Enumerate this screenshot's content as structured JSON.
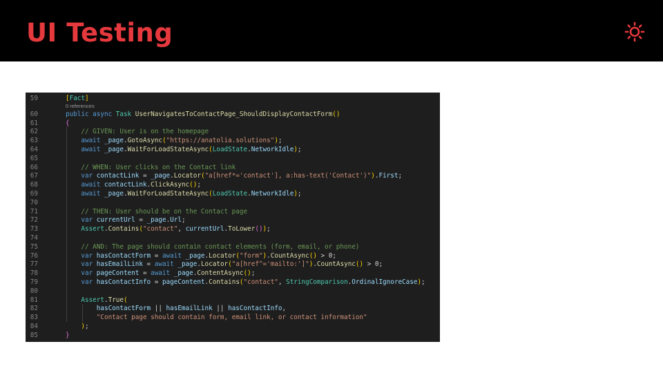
{
  "slide": {
    "title": "UI Testing",
    "icon": "sun-icon",
    "accent_color": "#e5393e"
  },
  "editor": {
    "codelens": "0 references",
    "line_numbers": [
      "59",
      "60",
      "61",
      "62",
      "63",
      "64",
      "65",
      "66",
      "67",
      "68",
      "69",
      "70",
      "71",
      "72",
      "73",
      "74",
      "75",
      "76",
      "77",
      "78",
      "79",
      "80",
      "81",
      "82",
      "83",
      "84",
      "85"
    ],
    "lines": [
      [
        {
          "t": "[",
          "c": "br2"
        },
        {
          "t": "Fact",
          "c": "at"
        },
        {
          "t": "]",
          "c": "br2"
        }
      ],
      [
        {
          "t": "public async ",
          "c": "kw"
        },
        {
          "t": "Task ",
          "c": "ty"
        },
        {
          "t": "UserNavigatesToContactPage_ShouldDisplayContactForm",
          "c": "fn"
        },
        {
          "t": "()",
          "c": "br2"
        }
      ],
      [
        {
          "t": "{",
          "c": "br"
        }
      ],
      [
        {
          "t": "    // GIVEN: User is on the homepage",
          "c": "cm"
        }
      ],
      [
        {
          "t": "    await ",
          "c": "kw"
        },
        {
          "t": "_page",
          "c": "vr"
        },
        {
          "t": "."
        },
        {
          "t": "GotoAsync",
          "c": "fn"
        },
        {
          "t": "(",
          "c": "br2"
        },
        {
          "t": "\"https://anatolia.solutions\"",
          "c": "st"
        },
        {
          "t": ")",
          "c": "br2"
        },
        {
          "t": ";"
        }
      ],
      [
        {
          "t": "    await ",
          "c": "kw"
        },
        {
          "t": "_page",
          "c": "vr"
        },
        {
          "t": "."
        },
        {
          "t": "WaitForLoadStateAsync",
          "c": "fn"
        },
        {
          "t": "(",
          "c": "br2"
        },
        {
          "t": "LoadState",
          "c": "ty"
        },
        {
          "t": "."
        },
        {
          "t": "NetworkIdle",
          "c": "vr"
        },
        {
          "t": ")",
          "c": "br2"
        },
        {
          "t": ";"
        }
      ],
      [],
      [
        {
          "t": "    // WHEN: User clicks on the Contact link",
          "c": "cm"
        }
      ],
      [
        {
          "t": "    var ",
          "c": "kw"
        },
        {
          "t": "contactLink",
          "c": "vr"
        },
        {
          "t": " = "
        },
        {
          "t": "_page",
          "c": "vr"
        },
        {
          "t": "."
        },
        {
          "t": "Locator",
          "c": "fn"
        },
        {
          "t": "(",
          "c": "br2"
        },
        {
          "t": "\"a[href*='contact'], a:has-text('Contact')\"",
          "c": "st"
        },
        {
          "t": ")",
          "c": "br2"
        },
        {
          "t": "."
        },
        {
          "t": "First",
          "c": "vr"
        },
        {
          "t": ";"
        }
      ],
      [
        {
          "t": "    await ",
          "c": "kw"
        },
        {
          "t": "contactLink",
          "c": "vr"
        },
        {
          "t": "."
        },
        {
          "t": "ClickAsync",
          "c": "fn"
        },
        {
          "t": "()",
          "c": "br2"
        },
        {
          "t": ";"
        }
      ],
      [
        {
          "t": "    await ",
          "c": "kw"
        },
        {
          "t": "_page",
          "c": "vr"
        },
        {
          "t": "."
        },
        {
          "t": "WaitForLoadStateAsync",
          "c": "fn"
        },
        {
          "t": "(",
          "c": "br2"
        },
        {
          "t": "LoadState",
          "c": "ty"
        },
        {
          "t": "."
        },
        {
          "t": "NetworkIdle",
          "c": "vr"
        },
        {
          "t": ")",
          "c": "br2"
        },
        {
          "t": ";"
        }
      ],
      [],
      [
        {
          "t": "    // THEN: User should be on the Contact page",
          "c": "cm"
        }
      ],
      [
        {
          "t": "    var ",
          "c": "kw"
        },
        {
          "t": "currentUrl",
          "c": "vr"
        },
        {
          "t": " = "
        },
        {
          "t": "_page",
          "c": "vr"
        },
        {
          "t": "."
        },
        {
          "t": "Url",
          "c": "vr"
        },
        {
          "t": ";"
        }
      ],
      [
        {
          "t": "    Assert",
          "c": "ty"
        },
        {
          "t": "."
        },
        {
          "t": "Contains",
          "c": "fn"
        },
        {
          "t": "(",
          "c": "br2"
        },
        {
          "t": "\"contact\"",
          "c": "st"
        },
        {
          "t": ", "
        },
        {
          "t": "currentUrl",
          "c": "vr"
        },
        {
          "t": "."
        },
        {
          "t": "ToLower",
          "c": "fn"
        },
        {
          "t": "()",
          "c": "br"
        },
        {
          "t": ")",
          "c": "br2"
        },
        {
          "t": ";"
        }
      ],
      [],
      [
        {
          "t": "    // AND: The page should contain contact elements (form, email, or phone)",
          "c": "cm"
        }
      ],
      [
        {
          "t": "    var ",
          "c": "kw"
        },
        {
          "t": "hasContactForm",
          "c": "vr"
        },
        {
          "t": " = "
        },
        {
          "t": "await ",
          "c": "kw"
        },
        {
          "t": "_page",
          "c": "vr"
        },
        {
          "t": "."
        },
        {
          "t": "Locator",
          "c": "fn"
        },
        {
          "t": "(",
          "c": "br2"
        },
        {
          "t": "\"form\"",
          "c": "st"
        },
        {
          "t": ")",
          "c": "br2"
        },
        {
          "t": "."
        },
        {
          "t": "CountAsync",
          "c": "fn"
        },
        {
          "t": "()",
          "c": "br2"
        },
        {
          "t": " > 0;"
        }
      ],
      [
        {
          "t": "    var ",
          "c": "kw"
        },
        {
          "t": "hasEmailLink",
          "c": "vr"
        },
        {
          "t": " = "
        },
        {
          "t": "await ",
          "c": "kw"
        },
        {
          "t": "_page",
          "c": "vr"
        },
        {
          "t": "."
        },
        {
          "t": "Locator",
          "c": "fn"
        },
        {
          "t": "(",
          "c": "br2"
        },
        {
          "t": "\"a[href^='mailto:']\"",
          "c": "st"
        },
        {
          "t": ")",
          "c": "br2"
        },
        {
          "t": "."
        },
        {
          "t": "CountAsync",
          "c": "fn"
        },
        {
          "t": "()",
          "c": "br2"
        },
        {
          "t": " > 0;"
        }
      ],
      [
        {
          "t": "    var ",
          "c": "kw"
        },
        {
          "t": "pageContent",
          "c": "vr"
        },
        {
          "t": " = "
        },
        {
          "t": "await ",
          "c": "kw"
        },
        {
          "t": "_page",
          "c": "vr"
        },
        {
          "t": "."
        },
        {
          "t": "ContentAsync",
          "c": "fn"
        },
        {
          "t": "()",
          "c": "br2"
        },
        {
          "t": ";"
        }
      ],
      [
        {
          "t": "    var ",
          "c": "kw"
        },
        {
          "t": "hasContactInfo",
          "c": "vr"
        },
        {
          "t": " = "
        },
        {
          "t": "pageContent",
          "c": "vr"
        },
        {
          "t": "."
        },
        {
          "t": "Contains",
          "c": "fn"
        },
        {
          "t": "(",
          "c": "br2"
        },
        {
          "t": "\"contact\"",
          "c": "st"
        },
        {
          "t": ", "
        },
        {
          "t": "StringComparison",
          "c": "ty"
        },
        {
          "t": "."
        },
        {
          "t": "OrdinalIgnoreCase",
          "c": "vr"
        },
        {
          "t": ")",
          "c": "br2"
        },
        {
          "t": ";"
        }
      ],
      [],
      [
        {
          "t": "    Assert",
          "c": "ty"
        },
        {
          "t": "."
        },
        {
          "t": "True",
          "c": "fn"
        },
        {
          "t": "(",
          "c": "br2"
        }
      ],
      [
        {
          "t": "        hasContactForm",
          "c": "vr"
        },
        {
          "t": " || "
        },
        {
          "t": "hasEmailLink",
          "c": "vr"
        },
        {
          "t": " || "
        },
        {
          "t": "hasContactInfo",
          "c": "vr"
        },
        {
          "t": ","
        }
      ],
      [
        {
          "t": "        \"Contact page should contain form, email link, or contact information\"",
          "c": "st"
        }
      ],
      [
        {
          "t": "    )",
          "c": "br2"
        },
        {
          "t": ";"
        }
      ],
      [
        {
          "t": "}",
          "c": "br"
        }
      ]
    ]
  }
}
